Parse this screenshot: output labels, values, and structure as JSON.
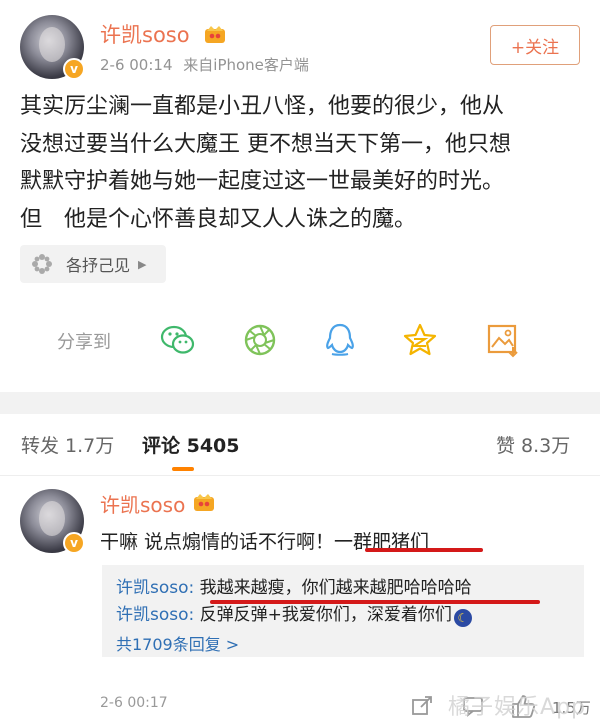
{
  "post": {
    "username": "许凯soso",
    "badge_letter": "v",
    "timestamp": "2-6 00:14",
    "source": "来自iPhone客户端",
    "follow_label": "+关注",
    "lines": [
      "其实厉尘澜一直都是小丑八怪，他要的很少，他从",
      "没想过要当什么大魔王 更不想当天下第一，他只想",
      "默默守护着她与她一起度过这一世最美好的时光。",
      "但　他是个心怀善良却又人人诛之的魔。"
    ],
    "tag_label": "各抒己见",
    "share_label": "分享到",
    "share_icons": [
      "wechat-icon",
      "moments-icon",
      "qq-icon",
      "qzone-icon",
      "save-image-icon"
    ]
  },
  "tabs": {
    "repost": "转发 1.7万",
    "comments": "评论 5405",
    "likes": "赞 8.3万"
  },
  "comment": {
    "username": "许凯soso",
    "badge_letter": "v",
    "text": "干嘛 说点煽情的话不行啊！一群肥猪们",
    "replies": [
      {
        "user": "许凯soso",
        "sep": ":",
        "text": " 我越来越瘦，你们越来越肥哈哈哈哈"
      },
      {
        "user": "许凯soso",
        "sep": ":",
        "text": " 反弹反弹+我爱你们，深爱着你们"
      }
    ],
    "more_replies": "共1709条回复 >",
    "time": "2-6 00:17",
    "like_count": "1.5万"
  },
  "watermark": "橘子娱乐App",
  "colors": {
    "accent": "#eb7350",
    "link": "#2f6fb4",
    "tab_indicator": "#ff8200",
    "highlight_underline": "#d41919"
  }
}
